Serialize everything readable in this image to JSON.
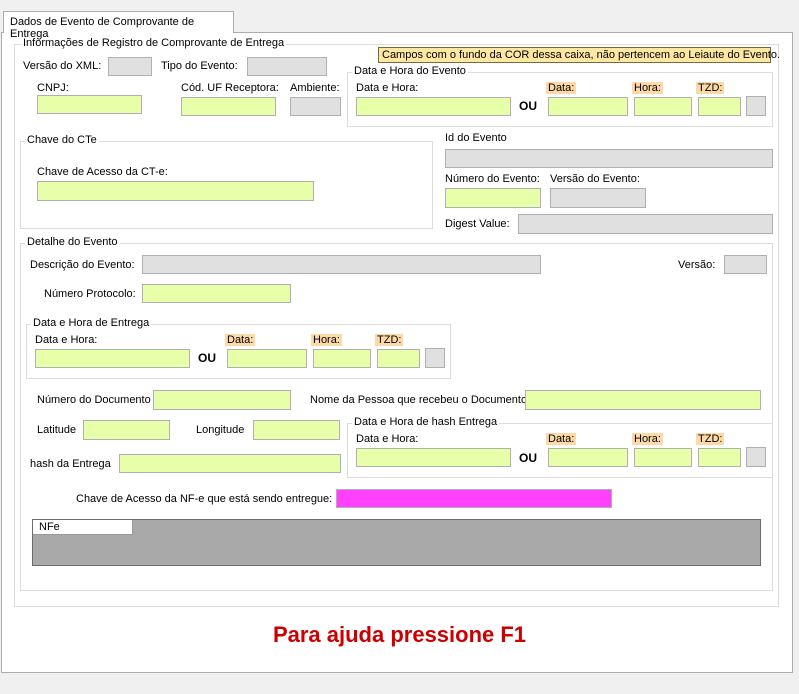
{
  "tab": {
    "label": "Dados de Evento de Comprovante de Entrega"
  },
  "registro": {
    "title": "Informações de Registro de Comprovante de Entrega",
    "versao_xml": "Versão do XML:",
    "tipo_evento": "Tipo do Evento:",
    "cnpj": "CNPJ:",
    "cod_uf": "Cód. UF Receptora:",
    "ambiente": "Ambiente:",
    "note": "Campos com o fundo da COR dessa caixa, não pertencem ao Leiaute do Evento."
  },
  "data_hora_evento": {
    "title": "Data e Hora do Evento",
    "data_hora": "Data e Hora:",
    "ou": "OU",
    "data": "Data:",
    "hora": "Hora:",
    "tzd": "TZD:"
  },
  "chave_cte": {
    "title": "Chave do CTe",
    "chave_label": "Chave de Acesso da CT-e:"
  },
  "id_evento": {
    "id_label": "Id do Evento",
    "numero_label": "Número do Evento:",
    "versao_label": "Versão do Evento:",
    "digest_label": "Digest Value:"
  },
  "detalhe": {
    "title": "Detalhe do Evento",
    "descricao": "Descrição do Evento:",
    "versao": "Versão:",
    "protocolo": "Número Protocolo:",
    "numero_documento": "Número do Documento",
    "nome_pessoa": "Nome da Pessoa que recebeu o Documento",
    "latitude": "Latitude",
    "longitude": "Longitude",
    "hash_entrega": "hash da Entrega",
    "chave_nfe": "Chave de Acesso da NF-e que está sendo entregue:",
    "nfe_tab": "NFe"
  },
  "data_hora_entrega": {
    "title": "Data e Hora de Entrega",
    "data_hora": "Data e Hora:",
    "ou": "OU",
    "data": "Data:",
    "hora": "Hora:",
    "tzd": "TZD:"
  },
  "data_hora_hash": {
    "title": "Data e Hora de hash Entrega",
    "data_hora": "Data e Hora:",
    "ou": "OU",
    "data": "Data:",
    "hora": "Hora:",
    "tzd": "TZD:"
  },
  "help": "Para ajuda pressione F1",
  "colors": {
    "required": "#e6ffa8",
    "readonly": "#e0e0e0",
    "highlight": "#ff40ff",
    "help_text": "#cc0000"
  }
}
